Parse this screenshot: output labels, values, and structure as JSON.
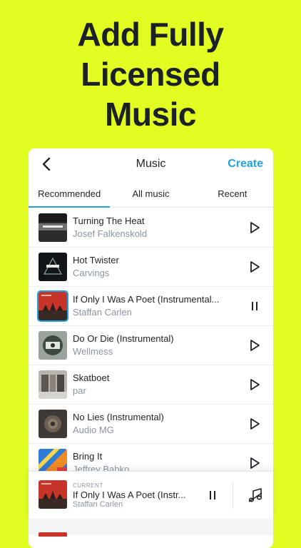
{
  "promo": {
    "line1": "Add Fully",
    "line2": "Licensed",
    "line3": "Music"
  },
  "header": {
    "title": "Music",
    "create_label": "Create",
    "back_icon": "chevron-left-icon"
  },
  "tabs": [
    {
      "label": "Recommended",
      "active": true
    },
    {
      "label": "All music",
      "active": false
    },
    {
      "label": "Recent",
      "active": false
    }
  ],
  "tracks": [
    {
      "title": "Turning The Heat",
      "artist": "Josef Falkenskold",
      "state": "play"
    },
    {
      "title": "Hot Twister",
      "artist": "Carvings",
      "state": "play"
    },
    {
      "title": "If Only I Was A Poet (Instrumental...",
      "artist": "Staffan Carlen",
      "state": "pause"
    },
    {
      "title": "Do Or Die (Instrumental)",
      "artist": "Wellmess",
      "state": "play"
    },
    {
      "title": "Skatboet",
      "artist": "par",
      "state": "play"
    },
    {
      "title": "No Lies (Instrumental)",
      "artist": "Audio MG",
      "state": "play"
    },
    {
      "title": "Bring It",
      "artist": "Jeffrey Babko",
      "state": "play"
    }
  ],
  "player": {
    "label": "CURRENT",
    "title": "If Only I Was A Poet (Instr...",
    "artist": "Staffan Carlen",
    "pause_icon": "pause-icon",
    "music_icon": "music-note-icon"
  },
  "colors": {
    "background": "#e1fd21",
    "accent": "#1fa1de",
    "text": "#1f2328",
    "muted": "#8c95a0"
  }
}
